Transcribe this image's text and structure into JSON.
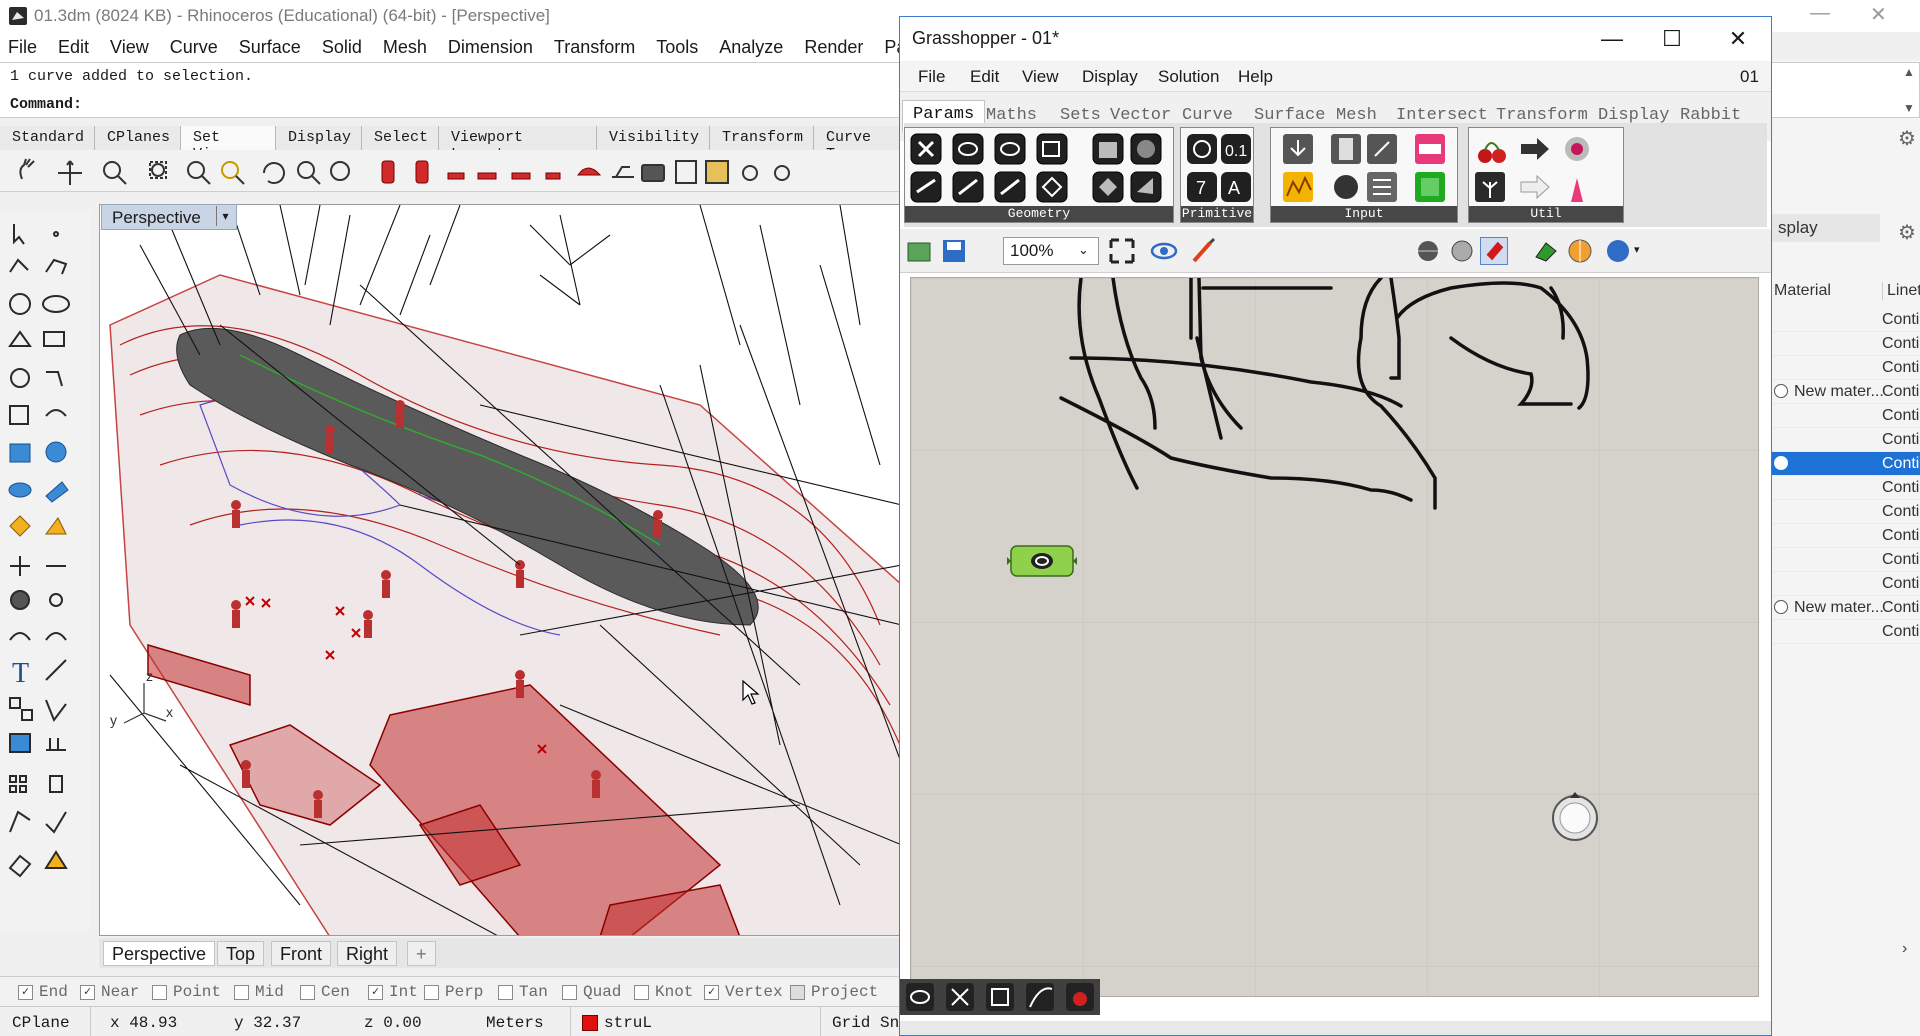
{
  "rhino": {
    "title": "01.3dm (8024 KB) - Rhinoceros (Educational) (64-bit) - [Perspective]",
    "menu": [
      "File",
      "Edit",
      "View",
      "Curve",
      "Surface",
      "Solid",
      "Mesh",
      "Dimension",
      "Transform",
      "Tools",
      "Analyze",
      "Render",
      "Par"
    ],
    "command_history": "1 curve added to selection.",
    "command_prompt": "Command:",
    "toolbar_tabs": [
      "Standard",
      "CPlanes",
      "Set View",
      "Display",
      "Select",
      "Viewport Layout",
      "Visibility",
      "Transform",
      "Curve T"
    ],
    "active_toolbar_tab": "Set View",
    "viewport_label": "Perspective",
    "viewport_tabs": [
      "Perspective",
      "Top",
      "Front",
      "Right",
      "+"
    ],
    "axes": {
      "x": "x",
      "y": "y",
      "z": "z"
    },
    "osnaps": [
      {
        "label": "End",
        "checked": true
      },
      {
        "label": "Near",
        "checked": true
      },
      {
        "label": "Point",
        "checked": false
      },
      {
        "label": "Mid",
        "checked": false
      },
      {
        "label": "Cen",
        "checked": false
      },
      {
        "label": "Int",
        "checked": true
      },
      {
        "label": "Perp",
        "checked": false
      },
      {
        "label": "Tan",
        "checked": false
      },
      {
        "label": "Quad",
        "checked": false
      },
      {
        "label": "Knot",
        "checked": false
      },
      {
        "label": "Vertex",
        "checked": true
      },
      {
        "label": "Project",
        "checked": false
      }
    ],
    "status": {
      "cplane": "CPlane",
      "x": "x 48.93",
      "y": "y 32.37",
      "z": "z 0.00",
      "units": "Meters",
      "layer": "struL",
      "layer_color": "#e01010",
      "grid_snap": "Grid Sna"
    }
  },
  "panel": {
    "tab": "splay",
    "headers": {
      "material": "Material",
      "linetype": "Linet"
    },
    "rows": [
      {
        "material": "",
        "linetype": "Contir",
        "selected": false
      },
      {
        "material": "",
        "linetype": "Contir",
        "selected": false
      },
      {
        "material": "",
        "linetype": "Contir",
        "selected": false
      },
      {
        "material": "New mater...",
        "linetype": "Contir",
        "selected": false
      },
      {
        "material": "",
        "linetype": "Contir",
        "selected": false
      },
      {
        "material": "",
        "linetype": "Contir",
        "selected": false
      },
      {
        "material": "",
        "linetype": "Conti",
        "selected": true
      },
      {
        "material": "",
        "linetype": "Contir",
        "selected": false
      },
      {
        "material": "",
        "linetype": "Contir",
        "selected": false
      },
      {
        "material": "",
        "linetype": "Contir",
        "selected": false
      },
      {
        "material": "",
        "linetype": "Contir",
        "selected": false
      },
      {
        "material": "",
        "linetype": "Contir",
        "selected": false
      },
      {
        "material": "New mater...",
        "linetype": "Contir",
        "selected": false
      },
      {
        "material": "",
        "linetype": "Contir",
        "selected": false
      }
    ]
  },
  "grasshopper": {
    "title": "Grasshopper - 01*",
    "menu": [
      "File",
      "Edit",
      "View",
      "Display",
      "Solution",
      "Help"
    ],
    "doc_name": "01",
    "tabs": [
      "Params",
      "Maths",
      "Sets",
      "Vector",
      "Curve",
      "Surface",
      "Mesh",
      "Intersect",
      "Transform",
      "Display",
      "Rabbit"
    ],
    "active_tab": "Params",
    "ribbon_groups": [
      "Geometry",
      "Primitive",
      "Input",
      "Util"
    ],
    "zoom": "100%",
    "status_text": "",
    "accent": "#3a7bd5"
  }
}
